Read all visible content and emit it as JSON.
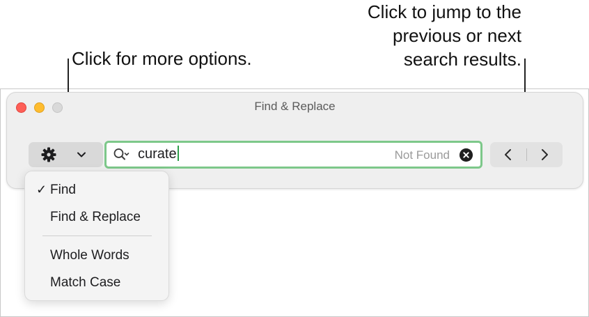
{
  "callouts": {
    "options": "Click for more options.",
    "nav_lines": [
      "Click to jump to the",
      "previous or next",
      "search results."
    ]
  },
  "window": {
    "title": "Find & Replace"
  },
  "search": {
    "value": "curate",
    "status": "Not Found"
  },
  "menu": {
    "items": [
      {
        "label": "Find",
        "checked": true
      },
      {
        "label": "Find & Replace",
        "checked": false
      },
      {
        "label": "Whole Words",
        "checked": false
      },
      {
        "label": "Match Case",
        "checked": false
      }
    ]
  },
  "icons": {
    "gear": "gear-icon",
    "chevron": "chevron-down-icon",
    "search": "magnifier-icon",
    "clear": "clear-icon",
    "prev": "chevron-left-icon",
    "next": "chevron-right-icon",
    "check": "checkmark-icon"
  },
  "colors": {
    "search_focus_ring": "#7dc88a",
    "close": "#fe5f57",
    "minimize": "#febc2e",
    "zoom": "#d9d9d9"
  }
}
